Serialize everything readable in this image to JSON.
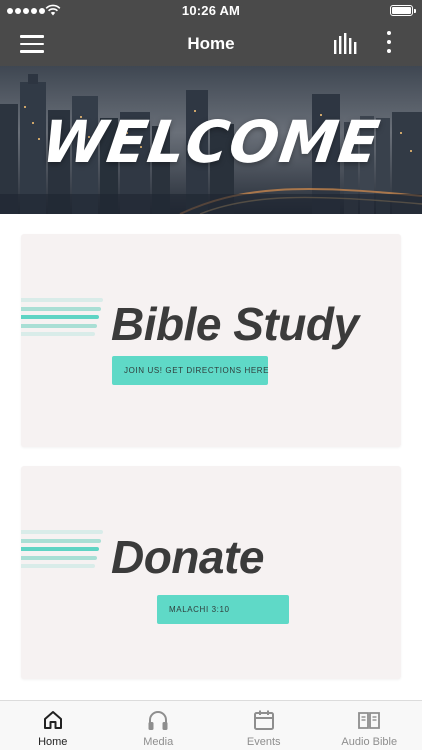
{
  "status_bar": {
    "time": "10:26 AM"
  },
  "nav": {
    "title": "Home",
    "menu_icon": "hamburger-menu-icon",
    "bars_icon": "audio-bars-icon",
    "more_icon": "more-vertical-icon"
  },
  "hero": {
    "title": "WELCOME"
  },
  "cards": [
    {
      "title": "Bible Study",
      "button_label": "JOIN US! GET DIRECTIONS HERE"
    },
    {
      "title": "Donate",
      "button_label": "MALACHI 3:10"
    }
  ],
  "tabs": [
    {
      "label": "Home",
      "icon": "home-icon",
      "active": true
    },
    {
      "label": "Media",
      "icon": "headphones-icon",
      "active": false
    },
    {
      "label": "Events",
      "icon": "calendar-icon",
      "active": false
    },
    {
      "label": "Audio Bible",
      "icon": "open-book-icon",
      "active": false
    }
  ],
  "colors": {
    "bar_bg": "#4a4a4a",
    "accent": "#5fd9c7",
    "card_bg": "#f6f2f2",
    "heading": "#3b3b3b"
  }
}
